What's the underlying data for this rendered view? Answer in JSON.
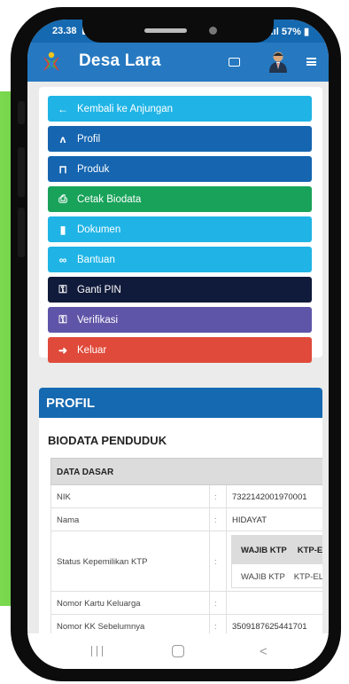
{
  "status_bar": {
    "time": "23.38",
    "battery": "57%"
  },
  "app": {
    "title": "Desa Lara"
  },
  "menu": [
    {
      "label": "Kembali ke Anjungan",
      "color": "#20b4e6",
      "icon": "arrow-left-circle-icon",
      "glyph": "←"
    },
    {
      "label": "Profil",
      "color": "#1565b0",
      "icon": "user-icon",
      "glyph": "ᴧ"
    },
    {
      "label": "Produk",
      "color": "#1565b0",
      "icon": "cart-icon",
      "glyph": "⊓"
    },
    {
      "label": "Cetak Biodata",
      "color": "#19a35a",
      "icon": "printer-icon",
      "glyph": "⎙"
    },
    {
      "label": "Dokumen",
      "color": "#20b4e6",
      "icon": "document-icon",
      "glyph": "▮"
    },
    {
      "label": "Bantuan",
      "color": "#20b4e6",
      "icon": "handshake-icon",
      "glyph": "∞"
    },
    {
      "label": "Ganti PIN",
      "color": "#101a3a",
      "icon": "key-icon",
      "glyph": "⚿"
    },
    {
      "label": "Verifikasi",
      "color": "#5f55a8",
      "icon": "key-icon",
      "glyph": "⚿"
    },
    {
      "label": "Keluar",
      "color": "#e04a3a",
      "icon": "logout-icon",
      "glyph": "➜"
    }
  ],
  "profile": {
    "heading": "PROFIL",
    "section_title": "BIODATA PENDUDUK",
    "table_header": "DATA DASAR",
    "rows": [
      {
        "label": "NIK",
        "colon": ":",
        "value": "7322142001970001"
      },
      {
        "label": "Nama",
        "colon": ":",
        "value": "HIDAYAT"
      },
      {
        "label": "Status Kepemilikan KTP",
        "colon": ":",
        "value": ""
      },
      {
        "label": "Nomor Kartu Keluarga",
        "colon": ":",
        "value": ""
      },
      {
        "label": "Nomor KK Sebelumnya",
        "colon": ":",
        "value": "3509187625441701"
      }
    ],
    "ktp_table": {
      "headers": [
        "WAJIB KTP",
        "KTP-El"
      ],
      "values": [
        "WAJIB KTP",
        "KTP-EL"
      ]
    }
  }
}
